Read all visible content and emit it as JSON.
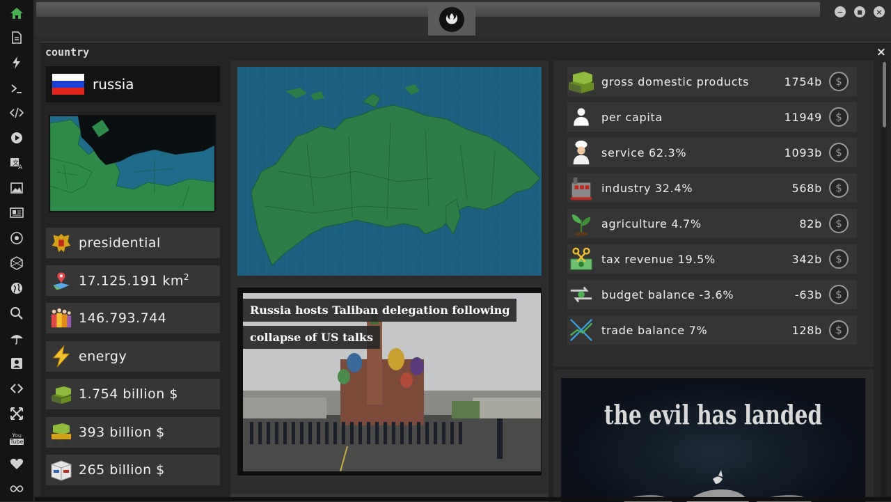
{
  "sidebar": {
    "items": [
      {
        "name": "home-icon",
        "glyph": "⌂"
      },
      {
        "name": "document-icon",
        "glyph": "▤"
      },
      {
        "name": "lightning-icon",
        "glyph": "ϟ"
      },
      {
        "name": "terminal-icon",
        "glyph": ">_"
      },
      {
        "name": "code-icon",
        "glyph": "</>"
      },
      {
        "name": "play-icon",
        "glyph": "▶"
      },
      {
        "name": "translate-icon",
        "glyph": "A"
      },
      {
        "name": "image-icon",
        "glyph": "▨"
      },
      {
        "name": "news-icon",
        "glyph": "▦"
      },
      {
        "name": "rebel-icon",
        "glyph": "✺"
      },
      {
        "name": "hexagon-icon",
        "glyph": "⬡"
      },
      {
        "name": "globe-icon",
        "glyph": "◍"
      },
      {
        "name": "search-icon",
        "glyph": "⌕"
      },
      {
        "name": "umbrella-icon",
        "glyph": "☂"
      },
      {
        "name": "contact-icon",
        "glyph": "▣"
      },
      {
        "name": "link-icon",
        "glyph": "⟡"
      },
      {
        "name": "expand-icon",
        "glyph": "✕"
      },
      {
        "name": "youtube-icon",
        "glyph": "You"
      },
      {
        "name": "heart-icon",
        "glyph": "♥"
      },
      {
        "name": "infinity-icon",
        "glyph": "∞"
      }
    ]
  },
  "window": {
    "minimize": "−",
    "maximize": "■",
    "close": "×"
  },
  "panel": {
    "title": "country",
    "close": "×"
  },
  "country": {
    "name": "russia",
    "flag_colors": [
      "#ffffff",
      "#1c3fd6",
      "#e2241b"
    ],
    "government": "presidential",
    "area_value": "17.125.191 km",
    "area_unit_sup": "2",
    "population": "146.793.744",
    "sector": "energy",
    "gdp": "1.754 billion $",
    "exports": "393 billion $",
    "imports": "265 billion $"
  },
  "news": {
    "headline_line1": "Russia hosts Taliban delegation following",
    "headline_line2": "collapse of US talks"
  },
  "economy": {
    "rows": [
      {
        "icon": "money-stack-icon",
        "label": "gross domestic products",
        "value": "1754b",
        "coin": "$"
      },
      {
        "icon": "person-icon",
        "label": "per capita",
        "value": "11949",
        "coin": "$"
      },
      {
        "icon": "chef-icon",
        "label": "service 62.3%",
        "value": "1093b",
        "coin": "$"
      },
      {
        "icon": "factory-icon",
        "label": "industry 32.4%",
        "value": "568b",
        "coin": "$"
      },
      {
        "icon": "plant-icon",
        "label": "agriculture 4.7%",
        "value": "82b",
        "coin": "$"
      },
      {
        "icon": "scissors-money-icon",
        "label": "tax revenue 19.5%",
        "value": "342b",
        "coin": "$"
      },
      {
        "icon": "transfer-icon",
        "label": "budget balance -3.6%",
        "value": "-63b",
        "coin": "$"
      },
      {
        "icon": "trade-icon",
        "label": "trade balance 7%",
        "value": "128b",
        "coin": "$"
      }
    ]
  },
  "promo": {
    "text": "the evil has landed"
  }
}
